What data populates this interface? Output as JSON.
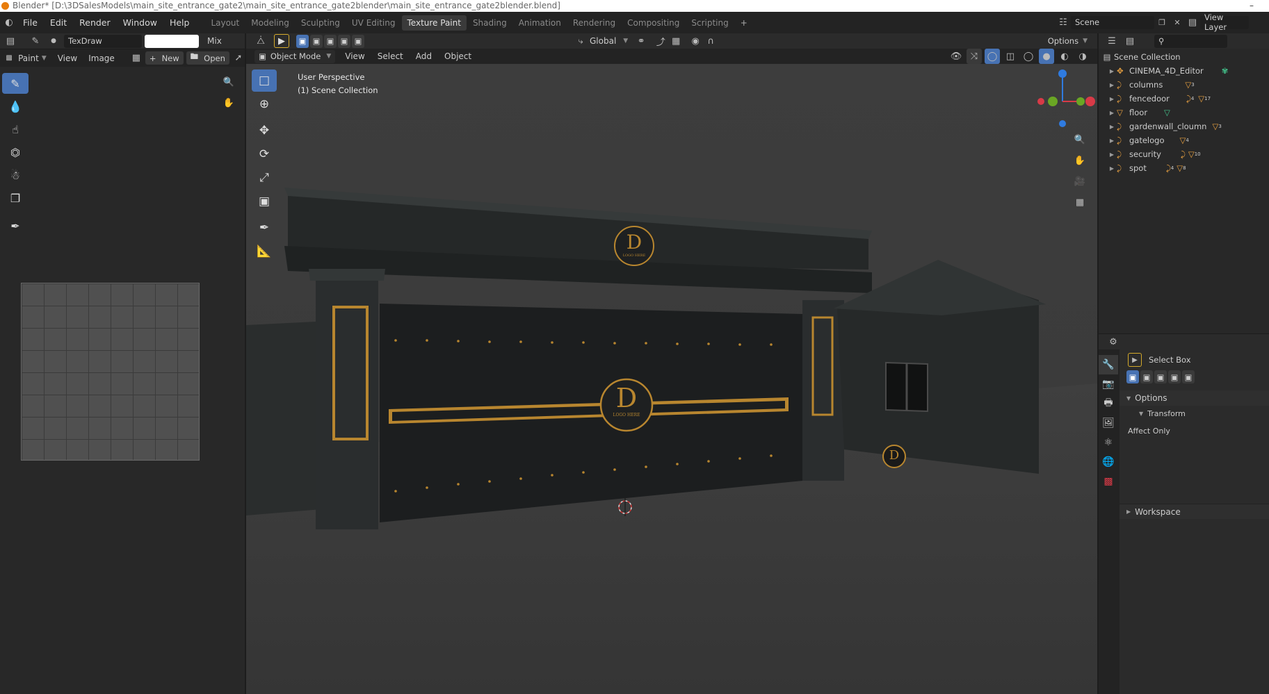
{
  "title_bar": {
    "text": "Blender* [D:\\3DSalesModels\\main_site_entrance_gate2\\main_site_entrance_gate2blender\\main_site_entrance_gate2blender.blend]",
    "minimize": "–"
  },
  "menu": [
    "File",
    "Edit",
    "Render",
    "Window",
    "Help"
  ],
  "workspaces": [
    "Layout",
    "Modeling",
    "Sculpting",
    "UV Editing",
    "Texture Paint",
    "Shading",
    "Animation",
    "Rendering",
    "Compositing",
    "Scripting"
  ],
  "active_workspace": "Texture Paint",
  "add_workspace": "+",
  "scene": {
    "label": "Scene",
    "view_layer": "View Layer"
  },
  "image_editor": {
    "brush": "TexDraw",
    "blend": "Mix",
    "mode": "Paint",
    "menus": [
      "View",
      "Image"
    ],
    "new_label": "New",
    "open_label": "Open"
  },
  "viewport": {
    "mode": "Object Mode",
    "menus": [
      "View",
      "Select",
      "Add",
      "Object"
    ],
    "orientation": "Global",
    "options_label": "Options",
    "overlay_line1": "User Perspective",
    "overlay_line2": "(1) Scene Collection",
    "logo_letter": "D",
    "logo_text": "LOGO HERE"
  },
  "outliner": {
    "root": "Scene Collection",
    "items": [
      {
        "name": "CINEMA_4D_Editor",
        "badges": []
      },
      {
        "name": "columns",
        "badges": [
          "3"
        ]
      },
      {
        "name": "fencedoor",
        "badges": [
          "4",
          "17"
        ]
      },
      {
        "name": "floor",
        "badges": []
      },
      {
        "name": "gardenwall_cloumn",
        "badges": [
          "3"
        ]
      },
      {
        "name": "gatelogo",
        "badges": [
          "4"
        ]
      },
      {
        "name": "security",
        "badges": [
          "10"
        ]
      },
      {
        "name": "spot",
        "badges": [
          "4",
          "8"
        ]
      }
    ]
  },
  "properties": {
    "tool": "Select Box",
    "options_label": "Options",
    "transform_label": "Transform",
    "affect_only": "Affect Only",
    "workspace_label": "Workspace"
  },
  "colors": {
    "accent": "#4772b3",
    "logo_gold": "#b8862f",
    "x_axis": "#d83a47",
    "y_axis": "#6aa624",
    "z_axis": "#2f7be0"
  }
}
